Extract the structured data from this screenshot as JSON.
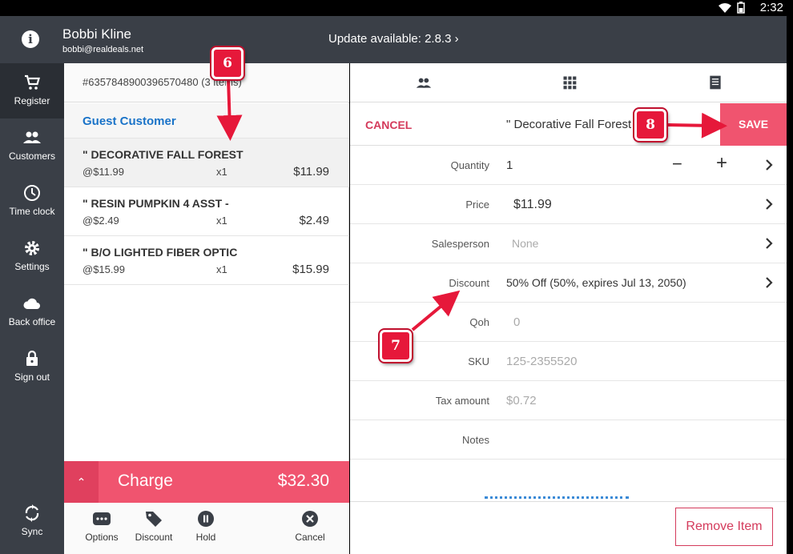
{
  "status": {
    "time": "2:32"
  },
  "topbar": {
    "user_name": "Bobbi Kline",
    "user_email": "bobbi@realdeals.net",
    "update_text": "Update available: 2.8.3 ›"
  },
  "sidebar": {
    "items": [
      {
        "label": "Register",
        "icon": "cart-icon"
      },
      {
        "label": "Customers",
        "icon": "people-icon"
      },
      {
        "label": "Time clock",
        "icon": "clock-icon"
      },
      {
        "label": "Settings",
        "icon": "gear-icon"
      },
      {
        "label": "Back office",
        "icon": "cloud-icon"
      },
      {
        "label": "Sign out",
        "icon": "lock-icon"
      }
    ],
    "sync_label": "Sync"
  },
  "order": {
    "id_text": "#6357848900396570480 (3 items)",
    "customer": "Guest Customer",
    "items": [
      {
        "name": "\" DECORATIVE FALL FOREST",
        "price": "@$11.99",
        "qty": "x1",
        "total": "$11.99"
      },
      {
        "name": "\" RESIN PUMPKIN  4 ASST -",
        "price": "@$2.49",
        "qty": "x1",
        "total": "$2.49"
      },
      {
        "name": "\" B/O LIGHTED FIBER OPTIC",
        "price": "@$15.99",
        "qty": "x1",
        "total": "$15.99"
      }
    ],
    "charge_label": "Charge",
    "charge_amount": "$32.30"
  },
  "actions": {
    "options": "Options",
    "discount": "Discount",
    "hold": "Hold",
    "cancel": "Cancel"
  },
  "edit": {
    "cancel": "CANCEL",
    "title": "\" Decorative Fall Forest",
    "save": "SAVE",
    "fields": {
      "quantity_label": "Quantity",
      "quantity_value": "1",
      "price_label": "Price",
      "price_value": "$11.99",
      "salesperson_label": "Salesperson",
      "salesperson_value": "None",
      "discount_label": "Discount",
      "discount_value": "50% Off (50%, expires Jul 13, 2050)",
      "qoh_label": "Qoh",
      "qoh_value": "0",
      "sku_label": "SKU",
      "sku_value": "125-2355520",
      "tax_label": "Tax amount",
      "tax_value": "$0.72",
      "notes_label": "Notes"
    },
    "remove": "Remove Item"
  },
  "annotations": {
    "b6": "6",
    "b7": "7",
    "b8": "8",
    "color": "#e6183a"
  }
}
